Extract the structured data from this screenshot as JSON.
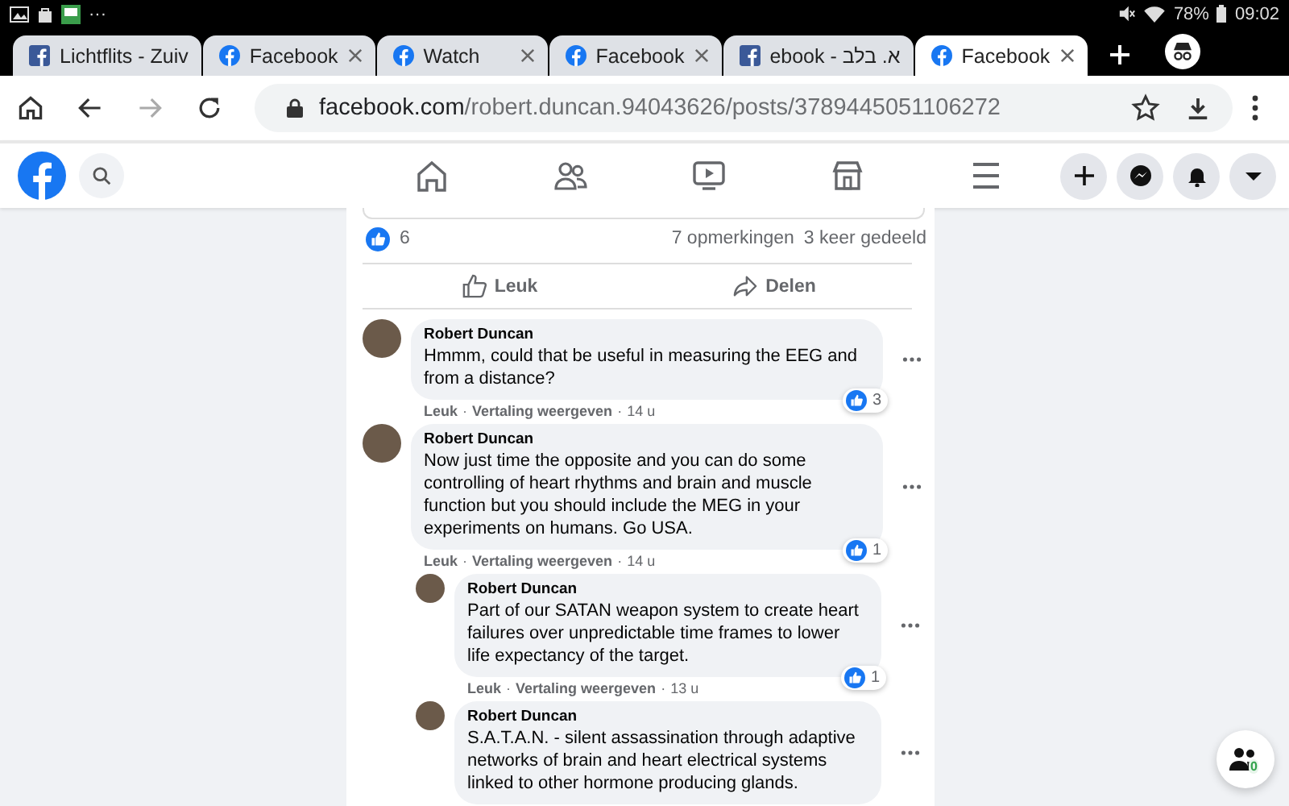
{
  "status_bar": {
    "more": "···",
    "battery": "78%",
    "time": "09:02"
  },
  "tabs": [
    {
      "title": "Lichtflits - Zuiv",
      "kind": "square",
      "selected": false
    },
    {
      "title": "Facebook",
      "kind": "round",
      "selected": false
    },
    {
      "title": "Watch",
      "kind": "round",
      "selected": false
    },
    {
      "title": "Facebook",
      "kind": "round",
      "selected": false
    },
    {
      "title": "ebook - א. בלב",
      "kind": "square",
      "selected": false
    },
    {
      "title": "Facebook",
      "kind": "round",
      "selected": true
    }
  ],
  "address_bar": {
    "host": "facebook.com",
    "path": "/robert.duncan.94043626/posts/3789445051106272"
  },
  "post": {
    "likes": "6",
    "comments": "7 opmerkingen",
    "shares": "3 keer gedeeld",
    "actions": [
      {
        "kind": "like",
        "label": "Leuk"
      },
      {
        "kind": "share",
        "label": "Delen"
      }
    ]
  },
  "comments": [
    {
      "author": "Robert Duncan",
      "text": "Hmmm, could that be useful in measuring the EEG and from a distance?",
      "meta": [
        {
          "kind": "link",
          "text": "Leuk"
        },
        {
          "kind": "sep",
          "text": "·"
        },
        {
          "kind": "link",
          "text": "Vertaling weergeven"
        },
        {
          "kind": "sep",
          "text": "·"
        },
        {
          "kind": "time",
          "text": "14 u"
        }
      ],
      "reactions": "3"
    },
    {
      "author": "Robert Duncan",
      "text": "Now just time the opposite and you can do some controlling of heart rhythms and brain and muscle function but you should include the MEG in your experiments on humans. Go USA.",
      "meta": [
        {
          "kind": "link",
          "text": "Leuk"
        },
        {
          "kind": "sep",
          "text": "·"
        },
        {
          "kind": "link",
          "text": "Vertaling weergeven"
        },
        {
          "kind": "sep",
          "text": "·"
        },
        {
          "kind": "time",
          "text": "14 u"
        }
      ],
      "reactions": "1",
      "children": [
        {
          "author": "Robert Duncan",
          "text": "Part of our SATAN weapon system to create heart failures over unpredictable time frames to lower life expectancy of the target.",
          "meta": [
            {
              "kind": "link",
              "text": "Leuk"
            },
            {
              "kind": "sep",
              "text": "·"
            },
            {
              "kind": "link",
              "text": "Vertaling weergeven"
            },
            {
              "kind": "sep",
              "text": "·"
            },
            {
              "kind": "time",
              "text": "13 u"
            }
          ],
          "reactions": "1"
        },
        {
          "author": "Robert Duncan",
          "text": "S.A.T.A.N. - silent assassination through adaptive networks of brain and heart electrical systems linked to other hormone producing glands."
        }
      ]
    }
  ],
  "contacts_button": {
    "count": "0"
  }
}
